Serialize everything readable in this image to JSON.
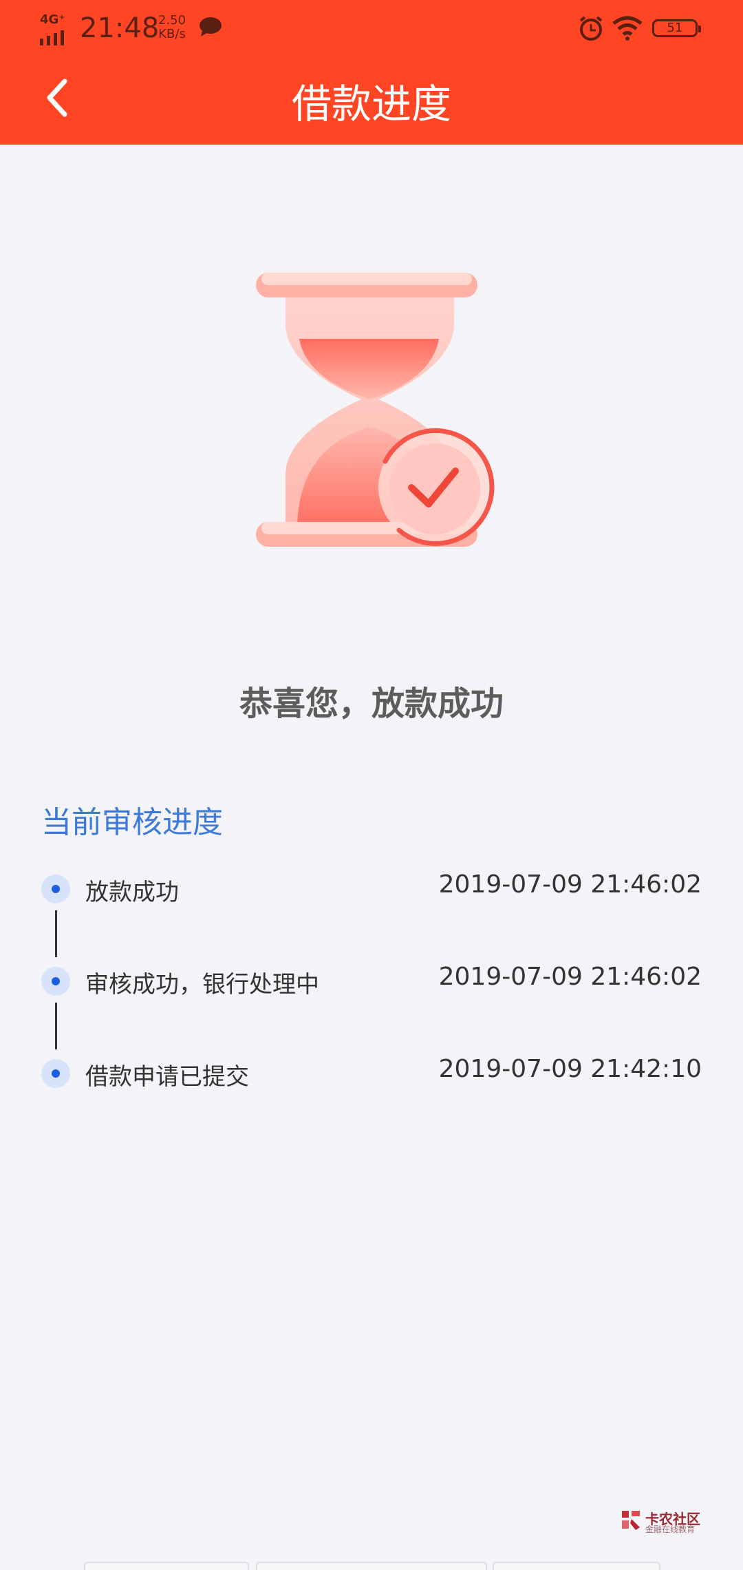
{
  "status_bar": {
    "network": "4G⁺",
    "time": "21:48",
    "speed_value": "2.50",
    "speed_unit": "KB/s",
    "battery": "51"
  },
  "header": {
    "title": "借款进度"
  },
  "hero": {
    "message": "恭喜您，放款成功"
  },
  "progress": {
    "section_title": "当前审核进度",
    "steps": [
      {
        "label": "放款成功",
        "time": "2019-07-09 21:46:02"
      },
      {
        "label": "审核成功，银行处理中",
        "time": "2019-07-09 21:46:02"
      },
      {
        "label": "借款申请已提交",
        "time": "2019-07-09 21:42:10"
      }
    ]
  },
  "watermark": {
    "text": "卡农社区",
    "subtext": "金融在线教育"
  },
  "colors": {
    "header": "#ff4524",
    "accent_blue": "#3c79d8",
    "dot_blue": "#1c5fe0"
  },
  "icons": [
    "back-arrow-icon",
    "hourglass-check-icon",
    "alarm-icon",
    "wifi-icon",
    "message-icon",
    "battery-icon"
  ]
}
